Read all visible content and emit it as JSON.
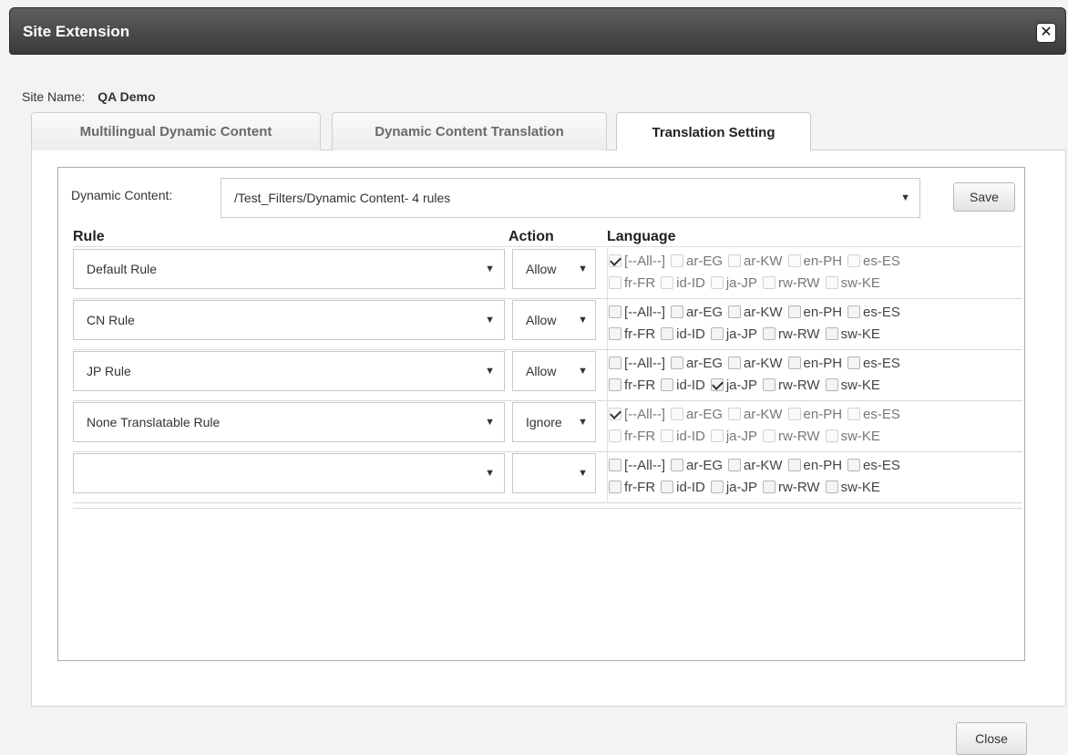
{
  "window": {
    "title": "Site Extension"
  },
  "site": {
    "label": "Site Name:",
    "value": "QA Demo"
  },
  "tabs": [
    {
      "label": "Multilingual Dynamic Content",
      "active": false
    },
    {
      "label": "Dynamic Content Translation",
      "active": false
    },
    {
      "label": "Translation Setting",
      "active": true
    }
  ],
  "dynamic_content": {
    "label": "Dynamic Content:",
    "selected": "/Test_Filters/Dynamic Content- 4 rules"
  },
  "buttons": {
    "save": "Save",
    "close": "Close"
  },
  "columns": {
    "rule": "Rule",
    "action": "Action",
    "language": "Language"
  },
  "languages": [
    "[--All--]",
    "ar-EG",
    "ar-KW",
    "en-PH",
    "es-ES",
    "fr-FR",
    "id-ID",
    "ja-JP",
    "rw-RW",
    "sw-KE"
  ],
  "rows": [
    {
      "rule": "Default Rule",
      "action": "Allow",
      "checked": [
        "[--All--]"
      ]
    },
    {
      "rule": "CN Rule",
      "action": "Allow",
      "checked": []
    },
    {
      "rule": "JP Rule",
      "action": "Allow",
      "checked": [
        "ja-JP"
      ]
    },
    {
      "rule": "None Translatable Rule",
      "action": "Ignore",
      "checked": [
        "[--All--]"
      ]
    },
    {
      "rule": "",
      "action": "",
      "checked": []
    }
  ]
}
